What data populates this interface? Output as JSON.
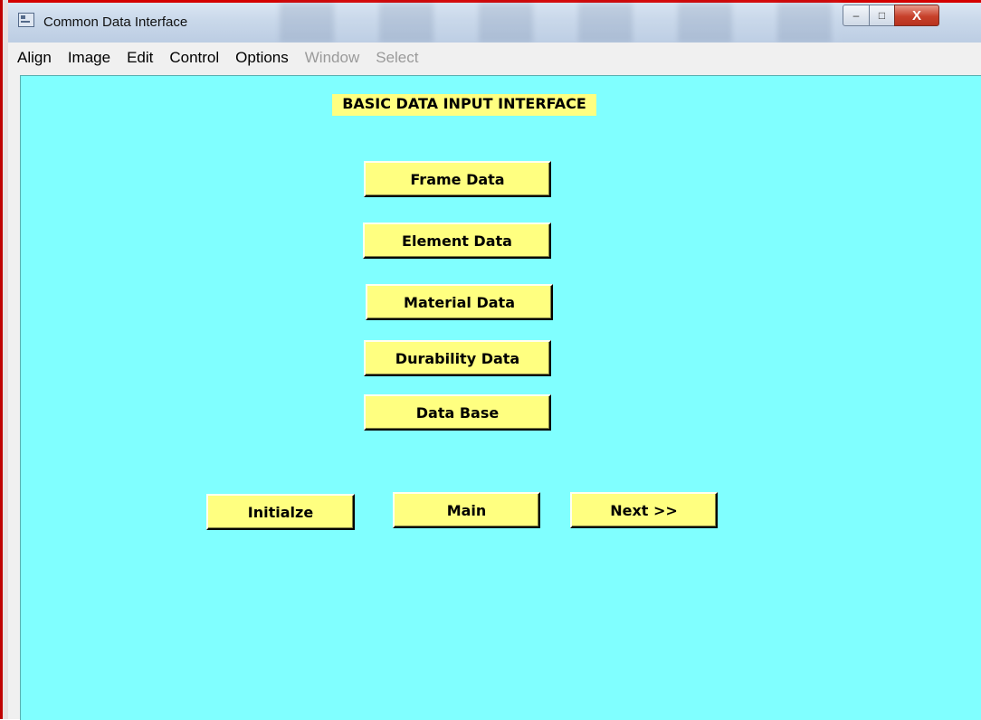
{
  "window": {
    "title": "Common Data Interface",
    "controls": {
      "minimize": "–",
      "maximize": "□",
      "close": "X"
    }
  },
  "menu": {
    "items": [
      {
        "label": "Align",
        "enabled": true
      },
      {
        "label": "Image",
        "enabled": true
      },
      {
        "label": "Edit",
        "enabled": true
      },
      {
        "label": "Control",
        "enabled": true
      },
      {
        "label": "Options",
        "enabled": true
      },
      {
        "label": "Window",
        "enabled": false
      },
      {
        "label": "Select",
        "enabled": false
      }
    ]
  },
  "panel": {
    "heading": "BASIC DATA INPUT INTERFACE",
    "buttons": {
      "frame": "Frame Data",
      "element": "Element Data",
      "material": "Material Data",
      "durability": "Durability Data",
      "database": "Data Base"
    },
    "nav": {
      "initialize": "Initialze",
      "main": "Main",
      "next": "Next  >>"
    }
  },
  "colors": {
    "background": "#80ffff",
    "button": "#ffff80",
    "frame_accent": "#d40000"
  }
}
